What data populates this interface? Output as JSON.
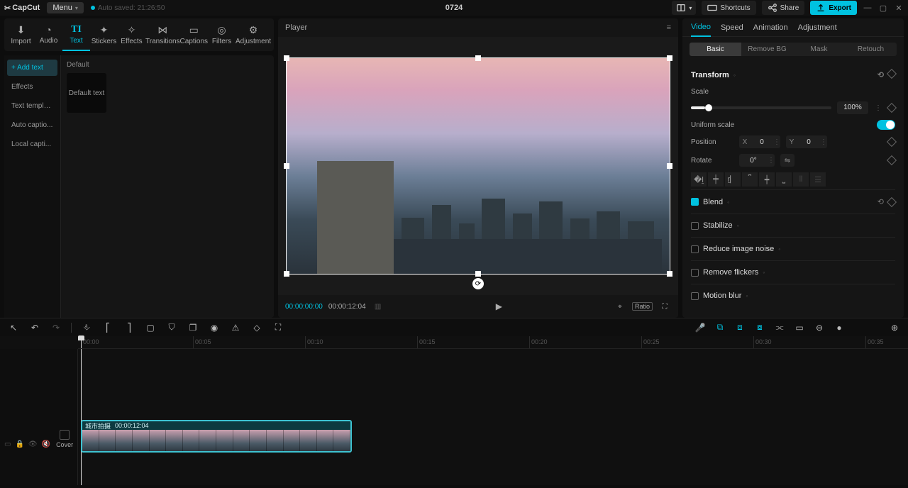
{
  "app": {
    "name": "CapCut",
    "menu_label": "Menu"
  },
  "autosave": {
    "label": "Auto saved: 21:26:50"
  },
  "project": {
    "title": "0724"
  },
  "title_actions": {
    "layout": "",
    "shortcuts": "Shortcuts",
    "share": "Share",
    "export": "Export"
  },
  "asset_tabs": [
    {
      "id": "import",
      "label": "Import"
    },
    {
      "id": "audio",
      "label": "Audio"
    },
    {
      "id": "text",
      "label": "Text"
    },
    {
      "id": "stickers",
      "label": "Stickers"
    },
    {
      "id": "effects",
      "label": "Effects"
    },
    {
      "id": "transitions",
      "label": "Transitions"
    },
    {
      "id": "captions",
      "label": "Captions"
    },
    {
      "id": "filters",
      "label": "Filters"
    },
    {
      "id": "adjustment",
      "label": "Adjustment"
    }
  ],
  "asset_side": [
    {
      "label": "Add text",
      "active": true
    },
    {
      "label": "Effects"
    },
    {
      "label": "Text template"
    },
    {
      "label": "Auto captio..."
    },
    {
      "label": "Local capti..."
    }
  ],
  "asset_content": {
    "group": "Default",
    "item": "Default text"
  },
  "player": {
    "title": "Player",
    "time_current": "00:00:00:00",
    "time_total": "00:00:12:04",
    "ratio": "Ratio"
  },
  "inspector": {
    "tabs": [
      "Video",
      "Speed",
      "Animation",
      "Adjustment"
    ],
    "active_tab": "Video",
    "subtabs": [
      "Basic",
      "Remove BG",
      "Mask",
      "Retouch"
    ],
    "active_subtab": "Basic",
    "transform_title": "Transform",
    "scale_label": "Scale",
    "scale_value": "100%",
    "uniform_label": "Uniform scale",
    "position_label": "Position",
    "pos_x": "0",
    "pos_y": "0",
    "rotate_label": "Rotate",
    "rotate_value": "0°",
    "blend_label": "Blend",
    "stabilize_label": "Stabilize",
    "reduce_noise_label": "Reduce image noise",
    "remove_flickers_label": "Remove flickers",
    "motion_blur_label": "Motion blur"
  },
  "timeline_toolbar": [
    "pointer",
    "undo",
    "redo",
    "|",
    "split",
    "left",
    "right",
    "crop",
    "shield",
    "copy",
    "record",
    "warn",
    "diamond",
    "square"
  ],
  "ruler": {
    "labels": [
      "00:00",
      "00:05",
      "00:10",
      "00:15",
      "00:20",
      "00:25",
      "00:30",
      "00:35"
    ]
  },
  "clip": {
    "name": "城市拍摄",
    "duration": "00:00:12:04"
  },
  "cover_label": "Cover"
}
